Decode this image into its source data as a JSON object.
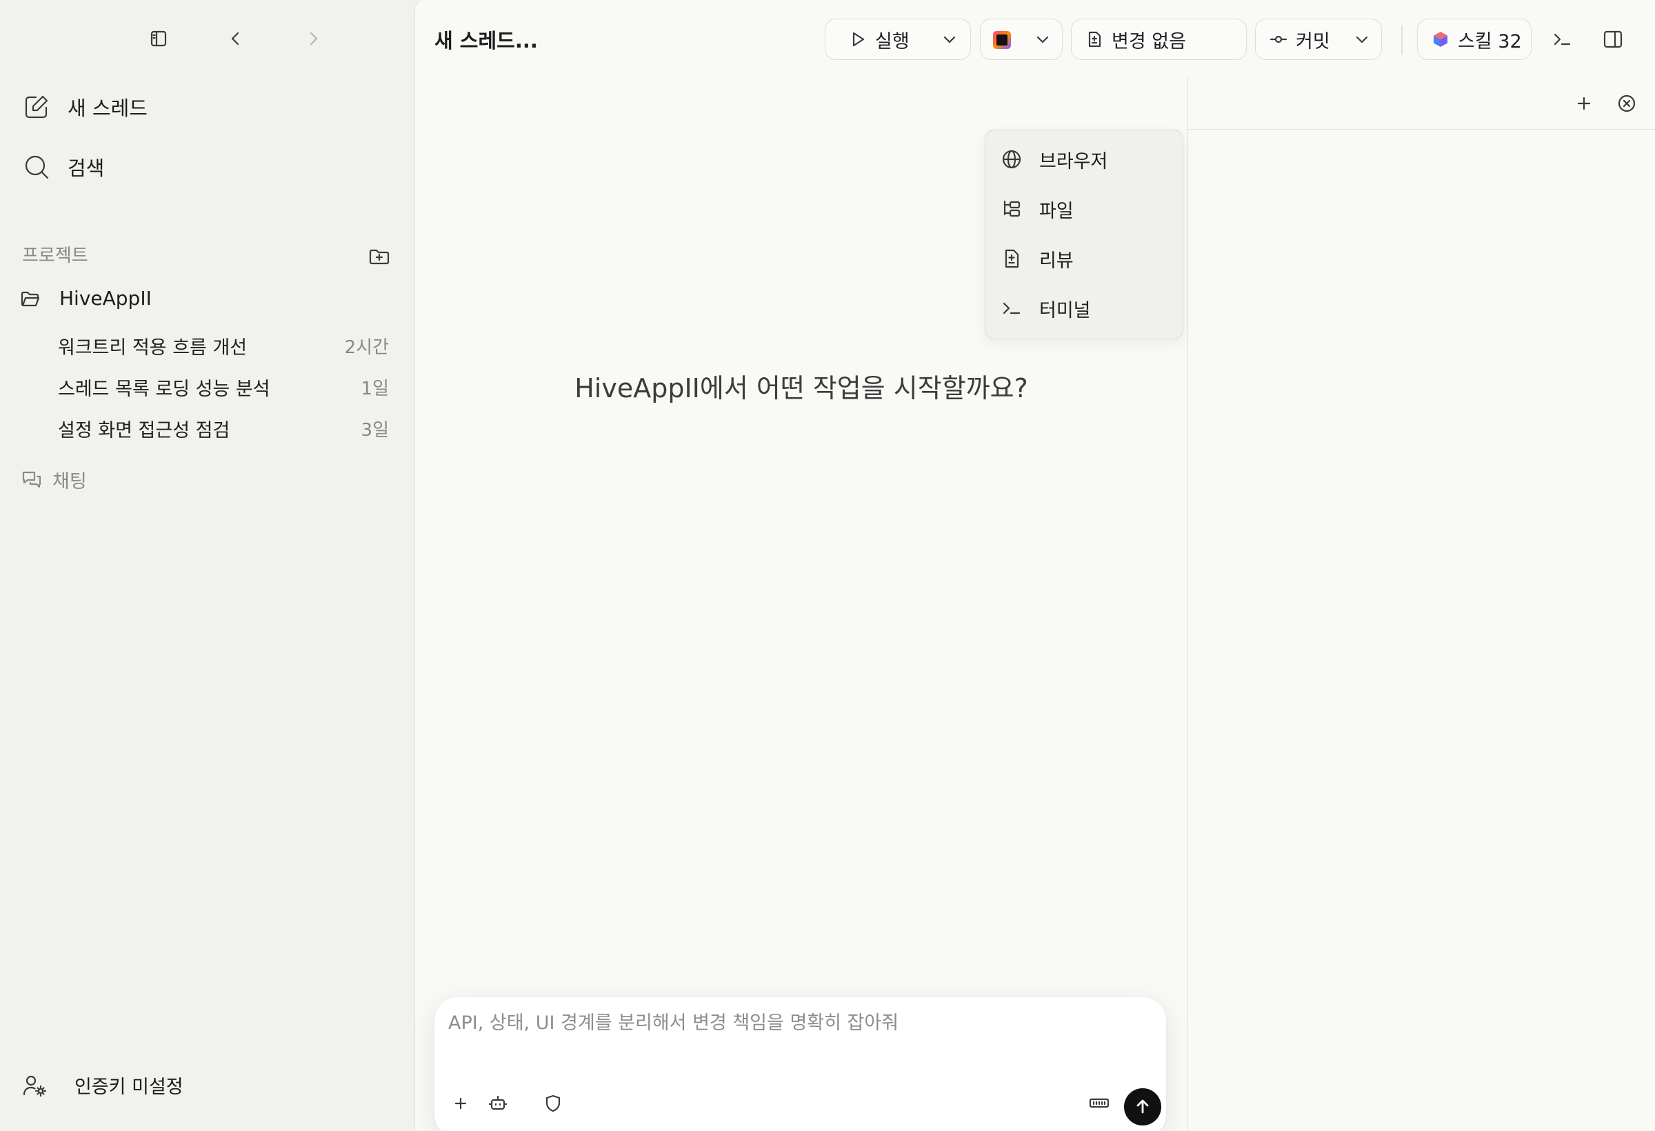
{
  "sidebar": {
    "new_thread": "새 스레드",
    "search": "검색",
    "projects_label": "프로젝트",
    "project_name": "HiveAppII",
    "threads": [
      {
        "title": "워크트리 적용 흐름 개선",
        "age": "2시간"
      },
      {
        "title": "스레드 목록 로딩 성능 분석",
        "age": "1일"
      },
      {
        "title": "설정 화면 접근성 점검",
        "age": "3일"
      }
    ],
    "chat": "채팅",
    "auth": "인증키 미설정"
  },
  "header": {
    "title": "새 스레드...",
    "run_label": "실행",
    "changes_label": "변경 없음",
    "commit_label": "커밋",
    "skills_label": "스킬 32"
  },
  "main": {
    "welcome": "HiveAppII에서 어떤 작업을 시작할까요?",
    "composer_placeholder": "API, 상태, UI 경계를 분리해서 변경 책임을 명확히 잡아줘"
  },
  "right_panel": {
    "menu": [
      {
        "label": "브라우저",
        "icon": "globe-icon"
      },
      {
        "label": "파일",
        "icon": "file-tree-icon"
      },
      {
        "label": "리뷰",
        "icon": "diff-file-icon"
      },
      {
        "label": "터미널",
        "icon": "terminal-icon"
      }
    ]
  },
  "colors": {
    "sidebar_bg": "#f1f1ee",
    "main_bg": "#f9f9f6",
    "send_button": "#111111"
  }
}
